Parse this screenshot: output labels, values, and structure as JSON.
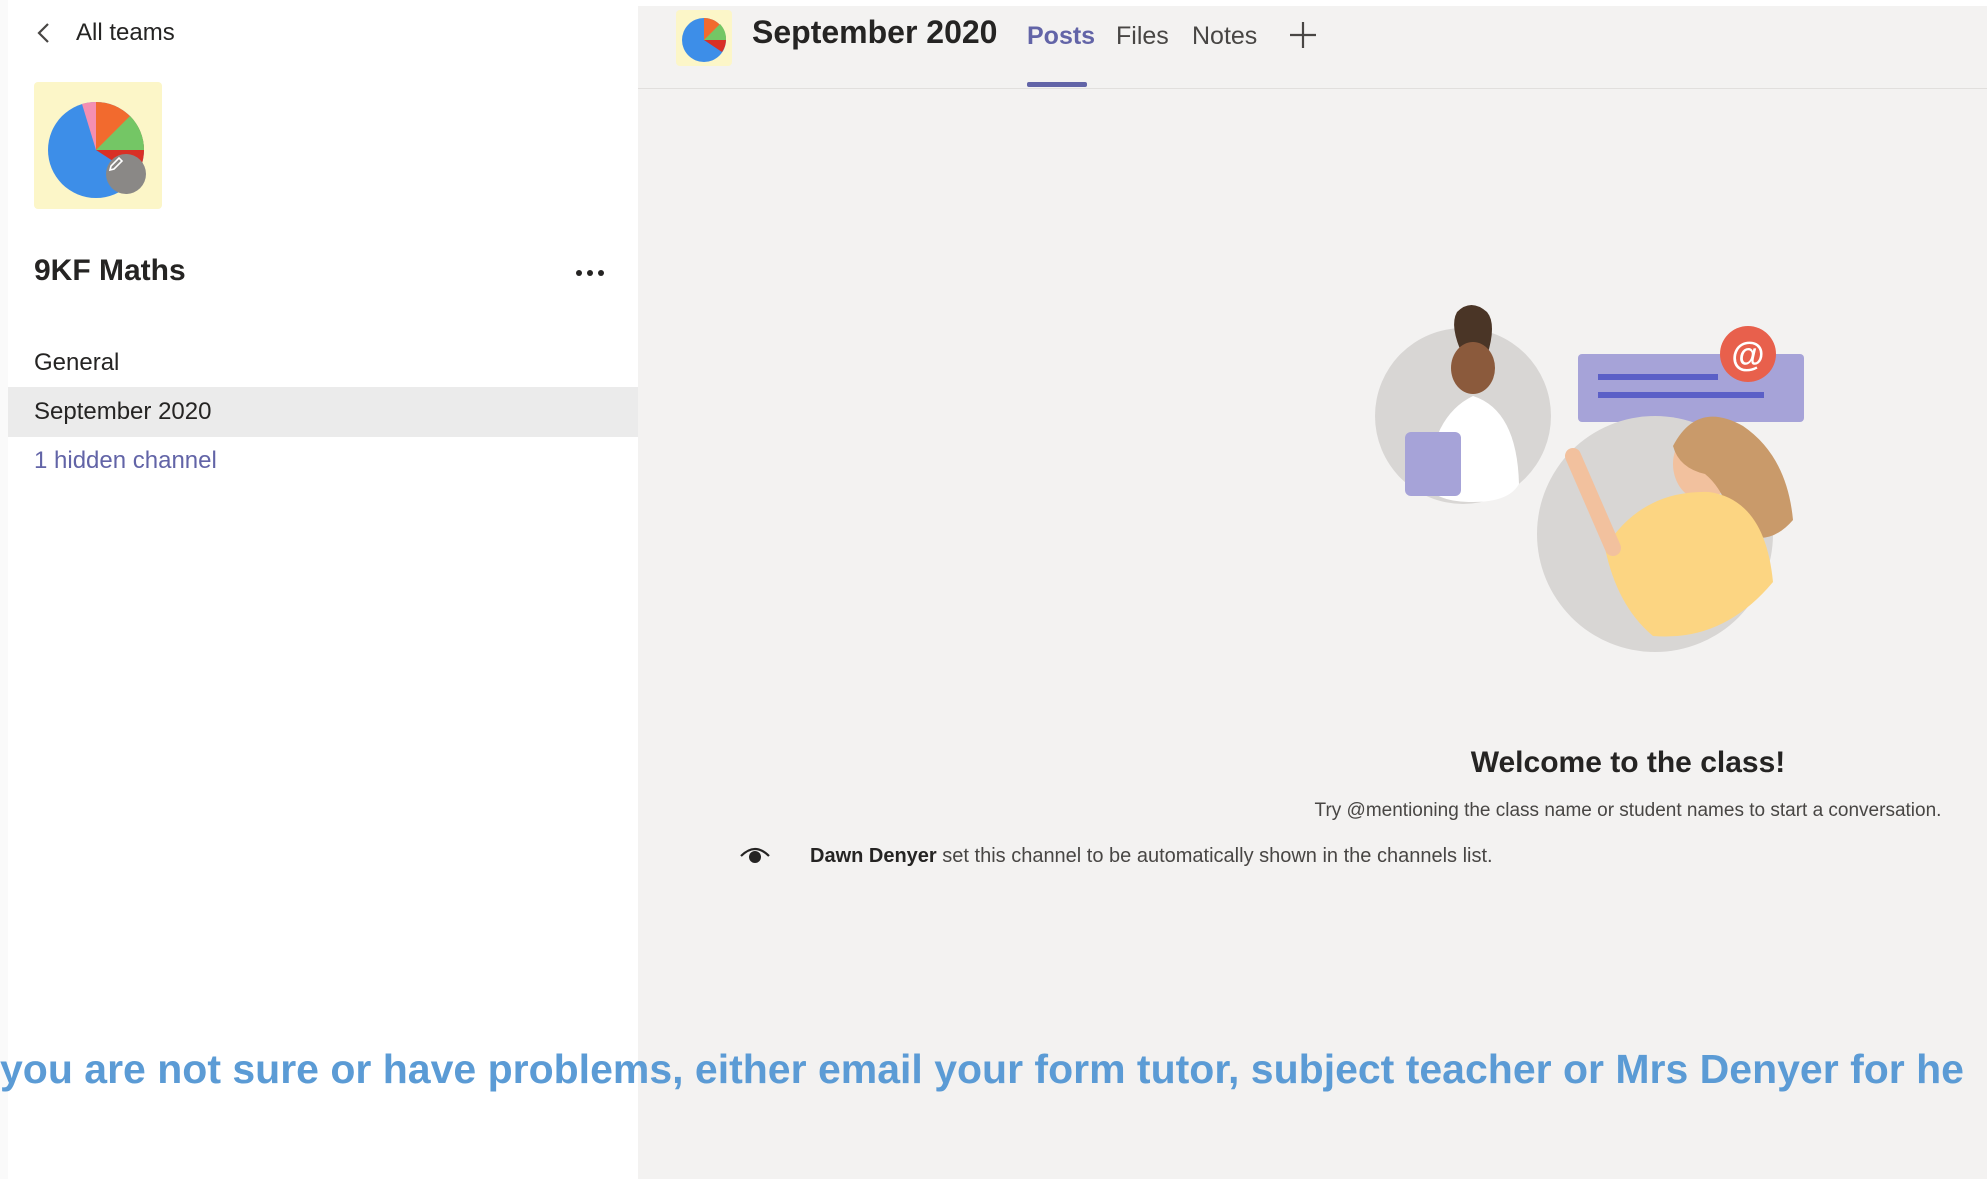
{
  "sidebar": {
    "back_label": "All teams",
    "team_name": "9KF Maths",
    "channels": [
      {
        "label": "General"
      },
      {
        "label": "September 2020"
      }
    ],
    "hidden_channels_label": "1 hidden channel"
  },
  "header": {
    "channel_title": "September 2020",
    "tabs": [
      {
        "label": "Posts"
      },
      {
        "label": "Files"
      },
      {
        "label": "Notes"
      }
    ]
  },
  "main": {
    "welcome_title": "Welcome to the class!",
    "welcome_hint": "Try @mentioning the class name or student names to start a conversation.",
    "system_message": {
      "author": "Dawn Denyer",
      "text": " set this channel to be automatically shown in the channels list."
    }
  },
  "banner_text": "you are not sure or have problems, either email your form tutor, subject teacher or Mrs Denyer for he",
  "colors": {
    "accent": "#6264a7",
    "banner": "#5b9bd5",
    "avatar_bg": "#fcf6c8",
    "main_bg": "#f3f2f1",
    "active_channel_bg": "#ebebeb"
  },
  "icons": [
    "chevron-left-icon",
    "pie-chart-icon",
    "pencil-icon",
    "more-options-icon",
    "plus-icon",
    "eye-icon",
    "at-mention-icon"
  ]
}
